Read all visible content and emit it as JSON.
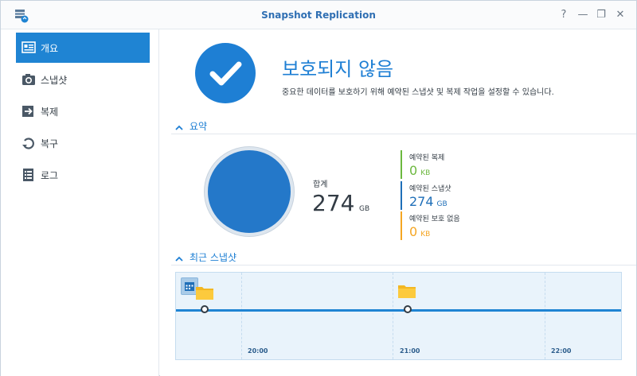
{
  "window": {
    "title": "Snapshot Replication",
    "help": "?",
    "minimize": "—",
    "maximize": "❐",
    "close": "✕"
  },
  "sidebar": {
    "items": [
      {
        "label": "개요",
        "icon": "overview-icon",
        "active": true
      },
      {
        "label": "스냅샷",
        "icon": "camera-icon"
      },
      {
        "label": "복제",
        "icon": "replication-icon"
      },
      {
        "label": "복구",
        "icon": "recovery-icon"
      },
      {
        "label": "로그",
        "icon": "log-icon"
      }
    ]
  },
  "status": {
    "title": "보호되지 않음",
    "description": "중요한 데이터를 보호하기 위해 예약된 스냅샷 및 복제 작업을 설정할 수 있습니다."
  },
  "summary": {
    "section_label": "요약",
    "total_label": "합계",
    "total_value": "274",
    "total_unit": "GB",
    "stats": [
      {
        "label": "예약된 복제",
        "value": "0",
        "unit": "KB",
        "color": "#6cb83f"
      },
      {
        "label": "예약된 스냅샷",
        "value": "274",
        "unit": "GB",
        "color": "#1f6fb8"
      },
      {
        "label": "예약된 보호 없음",
        "value": "0",
        "unit": "KB",
        "color": "#f5a623"
      }
    ]
  },
  "recent": {
    "section_label": "최근 스냅샷",
    "time_labels": [
      "20:00",
      "21:00",
      "22:00"
    ]
  },
  "colors": {
    "accent": "#1f84d3",
    "green": "#6cb83f",
    "orange": "#f5a623",
    "donut": "#2478c9"
  }
}
